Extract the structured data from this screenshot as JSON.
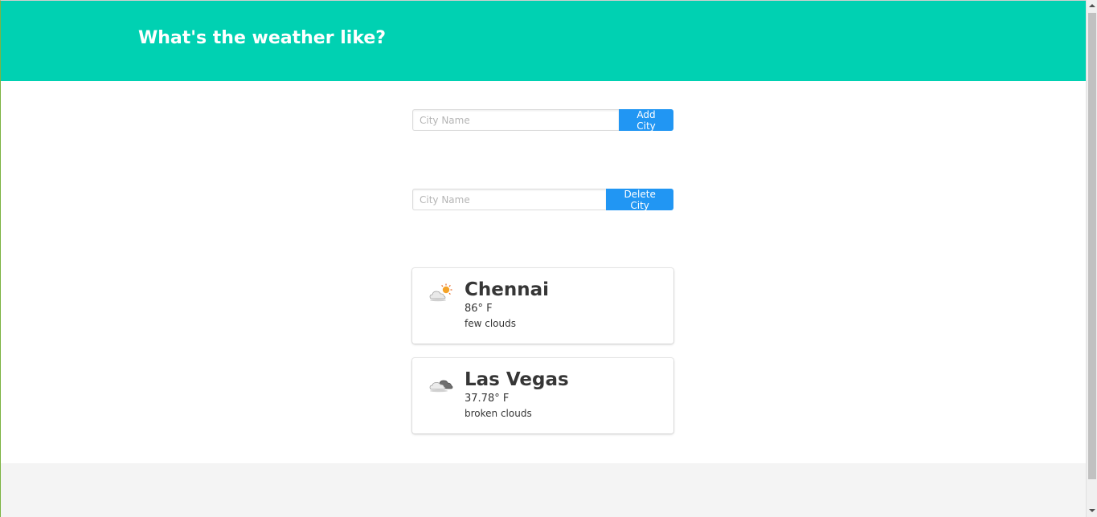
{
  "header": {
    "title": "What's the weather like?",
    "background_color": "#00d1b2"
  },
  "add_form": {
    "placeholder": "City Name",
    "value": "",
    "button_label": "Add City",
    "button_color": "#2196f3"
  },
  "delete_form": {
    "placeholder": "City Name",
    "value": "",
    "button_label": "Delete City",
    "button_color": "#2196f3"
  },
  "cities": [
    {
      "name": "Chennai",
      "temperature": "86° F",
      "description": "few clouds",
      "icon": "few-clouds-day-icon"
    },
    {
      "name": "Las Vegas",
      "temperature": "37.78° F",
      "description": "broken clouds",
      "icon": "broken-clouds-icon"
    }
  ],
  "footer": {
    "background_color": "#f4f4f4"
  }
}
